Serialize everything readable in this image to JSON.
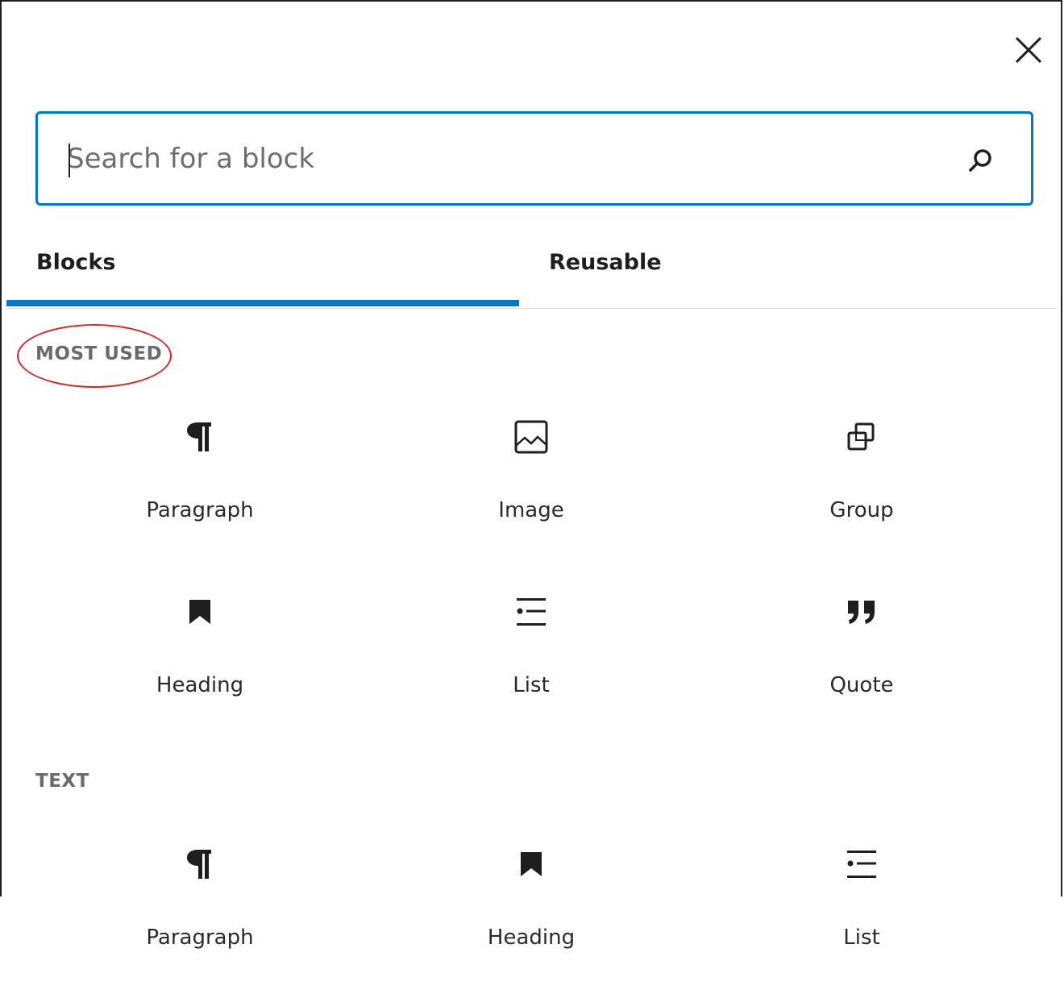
{
  "close_icon": "close-icon",
  "search": {
    "placeholder": "Search for a block",
    "value": "",
    "icon": "search-icon"
  },
  "tabs": [
    {
      "label": "Blocks",
      "active": true
    },
    {
      "label": "Reusable",
      "active": false
    }
  ],
  "colors": {
    "accent": "#0078c8",
    "annotation": "#d42a2a",
    "section_title": "#6b6b6b"
  },
  "sections": [
    {
      "title": "MOST USED",
      "highlighted": true,
      "blocks": [
        {
          "label": "Paragraph",
          "icon": "paragraph-icon"
        },
        {
          "label": "Image",
          "icon": "image-icon"
        },
        {
          "label": "Group",
          "icon": "group-icon"
        },
        {
          "label": "Heading",
          "icon": "heading-bookmark-icon"
        },
        {
          "label": "List",
          "icon": "list-icon"
        },
        {
          "label": "Quote",
          "icon": "quote-icon"
        }
      ]
    },
    {
      "title": "TEXT",
      "highlighted": false,
      "blocks": [
        {
          "label": "Paragraph",
          "icon": "paragraph-icon"
        },
        {
          "label": "Heading",
          "icon": "heading-bookmark-icon"
        },
        {
          "label": "List",
          "icon": "list-icon"
        }
      ]
    }
  ]
}
